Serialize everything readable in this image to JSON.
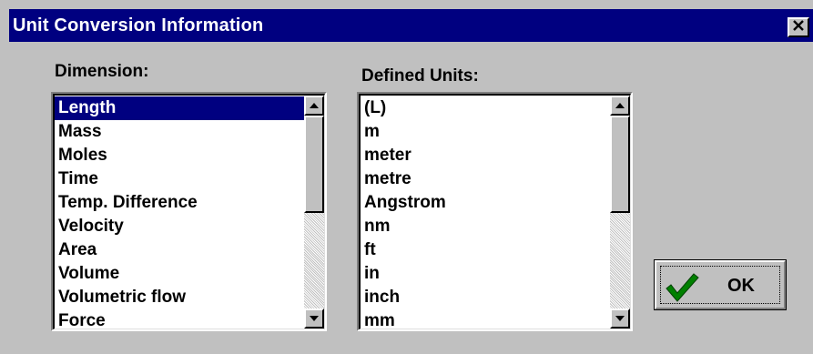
{
  "window": {
    "title": "Unit Conversion Information",
    "close_glyph": "✕"
  },
  "dimension": {
    "label": "Dimension:",
    "items": [
      "Length",
      "Mass",
      "Moles",
      "Time",
      "Temp. Difference",
      "Velocity",
      "Area",
      "Volume",
      "Volumetric flow",
      "Force"
    ],
    "selected": "Length"
  },
  "units": {
    "label": "Defined Units:",
    "items": [
      "(L)",
      "m",
      "meter",
      "metre",
      "Angstrom",
      "nm",
      "ft",
      "in",
      "inch",
      "mm"
    ]
  },
  "ok_button": {
    "label": "OK",
    "icon": "checkmark-icon",
    "icon_color": "#008000"
  },
  "colors": {
    "title_bar": "#000080",
    "selection": "#000080",
    "face": "#c0c0c0"
  }
}
